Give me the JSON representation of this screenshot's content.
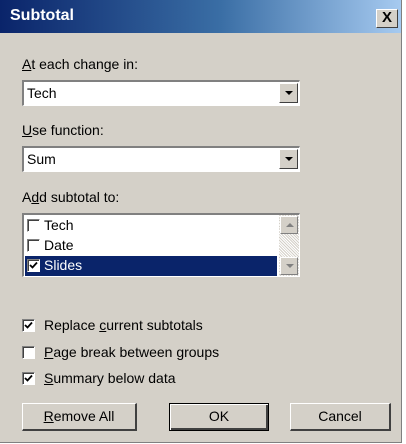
{
  "window": {
    "title": "Subtotal",
    "close_label": "X"
  },
  "change_in": {
    "label_before": "",
    "label_key": "A",
    "label_after": "t each change in:",
    "value": "Tech"
  },
  "function": {
    "label_key": "U",
    "label_after": "se function:",
    "value": "Sum"
  },
  "add_to": {
    "label_before": "A",
    "label_key": "d",
    "label_after": "d subtotal to:",
    "items": [
      {
        "label": "Tech",
        "checked": false,
        "selected": false
      },
      {
        "label": "Date",
        "checked": false,
        "selected": false
      },
      {
        "label": "Slides",
        "checked": true,
        "selected": true
      }
    ]
  },
  "options": {
    "replace": {
      "before": "Replace ",
      "key": "c",
      "after": "urrent subtotals",
      "checked": true
    },
    "page_break": {
      "before": "",
      "key": "P",
      "after": "age break between groups",
      "checked": false
    },
    "summary": {
      "before": "",
      "key": "S",
      "after": "ummary below data",
      "checked": true
    }
  },
  "buttons": {
    "remove_all": {
      "key": "R",
      "after": "emove All"
    },
    "ok": "OK",
    "cancel": "Cancel"
  }
}
